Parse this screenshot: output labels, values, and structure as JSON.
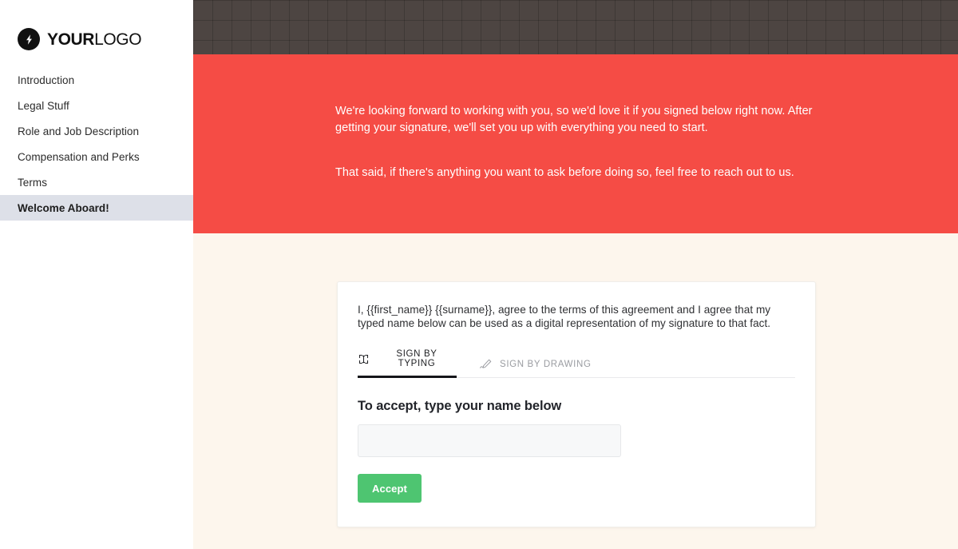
{
  "brand": {
    "logo_bold": "YOUR",
    "logo_light": "LOGO",
    "logo_icon": "lightning-bolt-icon"
  },
  "sidebar": {
    "items": [
      {
        "label": "Introduction",
        "active": false
      },
      {
        "label": "Legal Stuff",
        "active": false
      },
      {
        "label": "Role and Job Description",
        "active": false
      },
      {
        "label": "Compensation and Perks",
        "active": false
      },
      {
        "label": "Terms",
        "active": false
      },
      {
        "label": "Welcome Aboard!",
        "active": true
      }
    ]
  },
  "banner": {
    "paragraph_1": "We're looking forward to working with you, so we'd love it if you signed below right now. After getting your signature, we'll set you up with everything you need to start.",
    "paragraph_2": "That said, if there's anything you want to ask before doing so, feel free to reach out to us.",
    "background_color": "#f54c45",
    "text_color": "#ffffff"
  },
  "topbar": {
    "background_color": "#4d4542"
  },
  "content": {
    "background_color": "#fdf6ed"
  },
  "signature_card": {
    "consent_text": "I, {{first_name}} {{surname}}, agree to the terms of this agreement and I agree that my typed name below can be used as a digital representation of my signature to that fact.",
    "tabs": [
      {
        "label": "SIGN BY TYPING",
        "icon": "text-cursor-input-icon",
        "active": true
      },
      {
        "label": "SIGN BY DRAWING",
        "icon": "pen-draw-icon",
        "active": false
      }
    ],
    "form_title": "To accept, type your name below",
    "name_input_value": "",
    "name_input_placeholder": "",
    "accept_label": "Accept",
    "accept_color": "#4ec571"
  }
}
